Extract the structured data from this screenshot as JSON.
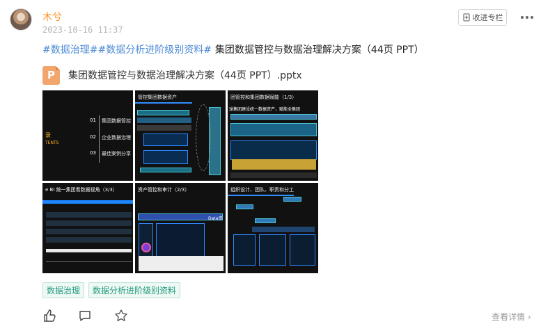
{
  "post": {
    "author": "木兮",
    "time": "2023-10-16 11:37",
    "collect_label": "收进专栏",
    "hashtags": "#数据治理##数据分析进阶级别资料#",
    "title": "集团数据管控与数据治理解决方案（44页 PPT）",
    "file_name": "集团数据管控与数据治理解决方案（44页 PPT）.pptx",
    "file_icon_letter": "P",
    "view_details": "查看详情",
    "tags": [
      "数据治理",
      "数据分析进阶级别资料"
    ]
  },
  "gallery": {
    "slide1": {
      "catalog": "录",
      "catalog_en": "TENTS",
      "items": [
        "01",
        "集团数据管控",
        "02",
        "企业数据治理",
        "03",
        "最佳案例分享"
      ]
    },
    "slide2": {
      "title": "管控集团数据资产"
    },
    "slide3": {
      "title": "团管控和集团数据赋能（1/3）",
      "subtitle": "球集团建设统一数据资产，赋能全集团"
    },
    "slide4": {
      "title": "e BI 统一集团看数据视角（3/3）"
    },
    "slide5": {
      "title": "资产管控和审计（2/3）",
      "label": "Data资"
    },
    "slide6": {
      "title": "组织设计、团队、职责和分工"
    }
  },
  "colors": {
    "accent": "#ff8f1f",
    "tag": "#219a7d",
    "link": "#4d8bd6"
  }
}
